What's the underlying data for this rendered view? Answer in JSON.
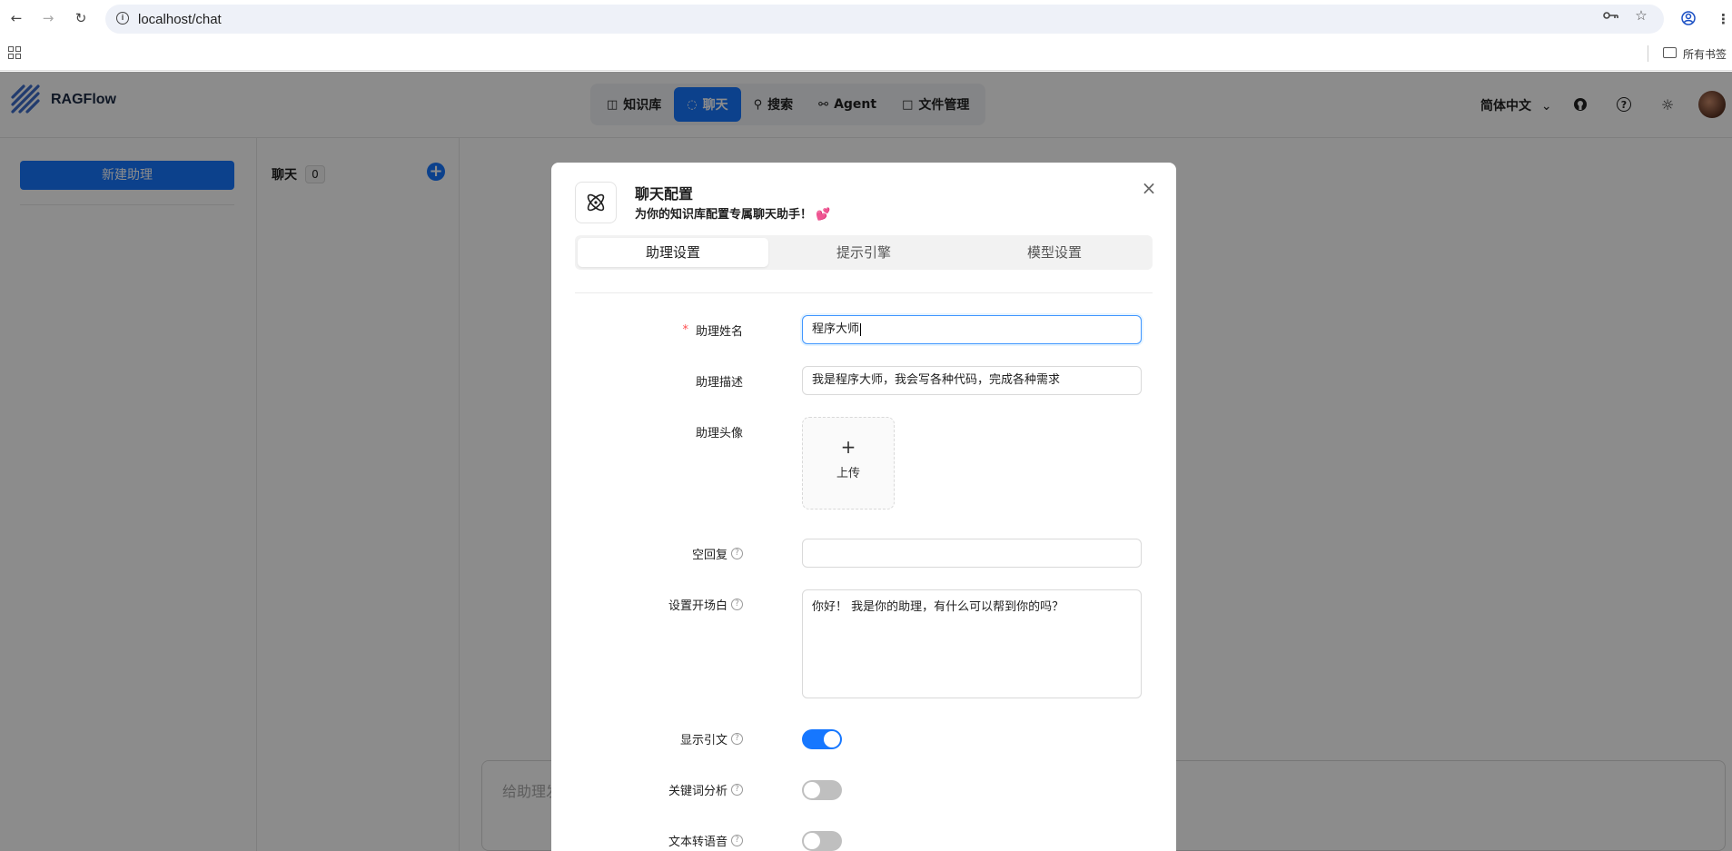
{
  "browser": {
    "url": "localhost/chat",
    "bookmarks_label": "所有书签"
  },
  "app": {
    "brand": "RAGFlow",
    "nav": [
      {
        "label": "知识库",
        "icon": "database-icon"
      },
      {
        "label": "聊天",
        "icon": "chat-icon"
      },
      {
        "label": "搜索",
        "icon": "search-icon"
      },
      {
        "label": "Agent",
        "icon": "graph-icon"
      },
      {
        "label": "文件管理",
        "icon": "folder-icon"
      }
    ],
    "active_nav": "聊天",
    "language": "简体中文",
    "new_assistant_label": "新建助理",
    "chat_list_title": "聊天",
    "chat_count": "0",
    "chat_input_placeholder": "给助理发"
  },
  "modal": {
    "title": "聊天配置",
    "subtitle": "为你的知识库配置专属聊天助手！",
    "subtitle_emoji": "💕",
    "tabs": [
      "助理设置",
      "提示引擎",
      "模型设置"
    ],
    "active_tab": "助理设置",
    "fields": {
      "name_label": "助理姓名",
      "name_value": "程序大师",
      "description_label": "助理描述",
      "description_value": "我是程序大师，我会写各种代码，完成各种需求",
      "avatar_label": "助理头像",
      "upload_label": "上传",
      "empty_reply_label": "空回复",
      "empty_reply_value": "",
      "opener_label": "设置开场白",
      "opener_value": "你好！ 我是你的助理，有什么可以帮到你的吗？",
      "show_quote_label": "显示引文",
      "show_quote": true,
      "keyword_label": "关键词分析",
      "keyword": false,
      "tts_label": "文本转语音",
      "tts": false
    }
  },
  "colors": {
    "primary": "#1677ff",
    "required": "#ff4d4f"
  }
}
